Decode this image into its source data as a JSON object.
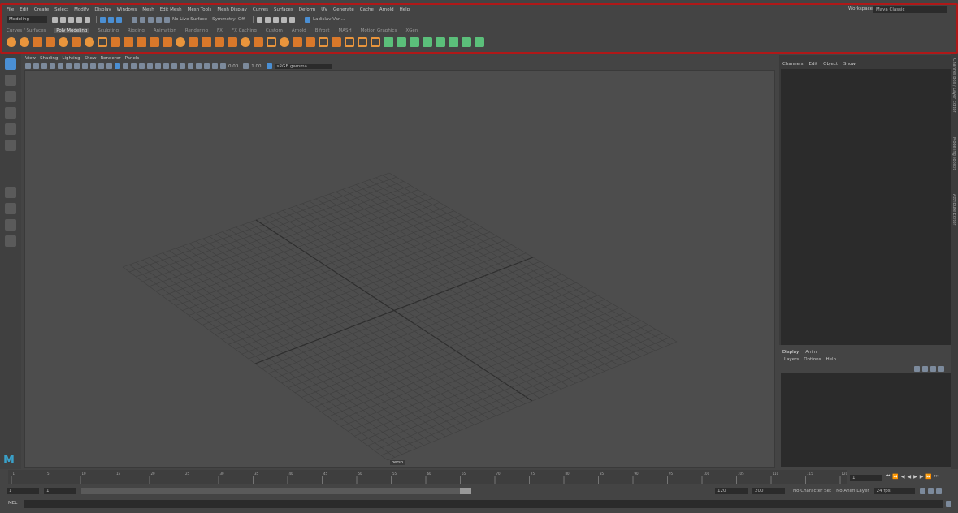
{
  "menubar": [
    "File",
    "Edit",
    "Create",
    "Select",
    "Modify",
    "Display",
    "Windows",
    "Mesh",
    "Edit Mesh",
    "Mesh Tools",
    "Mesh Display",
    "Curves",
    "Surfaces",
    "Deform",
    "UV",
    "Generate",
    "Cache",
    "Arnold",
    "Help"
  ],
  "workspace": {
    "label": "Workspace :",
    "value": "Maya Classic"
  },
  "statusline": {
    "mode": "Modeling",
    "no_live_surface": "No Live Surface",
    "symmetry": "Symmetry: Off",
    "user": "Ladislav Van..."
  },
  "shelf_tabs": [
    "Curves / Surfaces",
    "Poly Modeling",
    "Sculpting",
    "Rigging",
    "Animation",
    "Rendering",
    "FX",
    "FX Caching",
    "Custom",
    "Arnold",
    "Bifrost",
    "MASH",
    "Motion Graphics",
    "XGen"
  ],
  "shelf_active": "Poly Modeling",
  "viewport": {
    "menu": [
      "View",
      "Shading",
      "Lighting",
      "Show",
      "Renderer",
      "Panels"
    ],
    "field_a": "0.00",
    "field_b": "1.00",
    "color_space": "sRGB gamma",
    "camera": "persp"
  },
  "channelbox": {
    "menu": [
      "Channels",
      "Edit",
      "Object",
      "Show"
    ]
  },
  "layers": {
    "tabs": [
      "Display",
      "Anim"
    ],
    "menu": [
      "Layers",
      "Options",
      "Help"
    ]
  },
  "side_tabs": [
    "Channel Box / Layer Editor",
    "Modeling Toolkit",
    "Attribute Editor"
  ],
  "range": {
    "start": "1",
    "start2": "1",
    "end_slider": "120",
    "end": "120",
    "end2": "200",
    "char_set": "No Character Set",
    "anim_layer": "No Anim Layer",
    "fps": "24 fps"
  },
  "timeline": {
    "current": "1",
    "ticks": [
      "1",
      "5",
      "10",
      "15",
      "20",
      "25",
      "30",
      "35",
      "40",
      "45",
      "50",
      "55",
      "60",
      "65",
      "70",
      "75",
      "80",
      "85",
      "90",
      "95",
      "100",
      "105",
      "110",
      "115",
      "120"
    ]
  },
  "mel_label": "MEL",
  "colors": {
    "frame_highlight": "#b01818",
    "accent_blue": "#4a8fd4",
    "shelf_orange": "#e9953c",
    "shelf_green": "#5bbf7a"
  }
}
